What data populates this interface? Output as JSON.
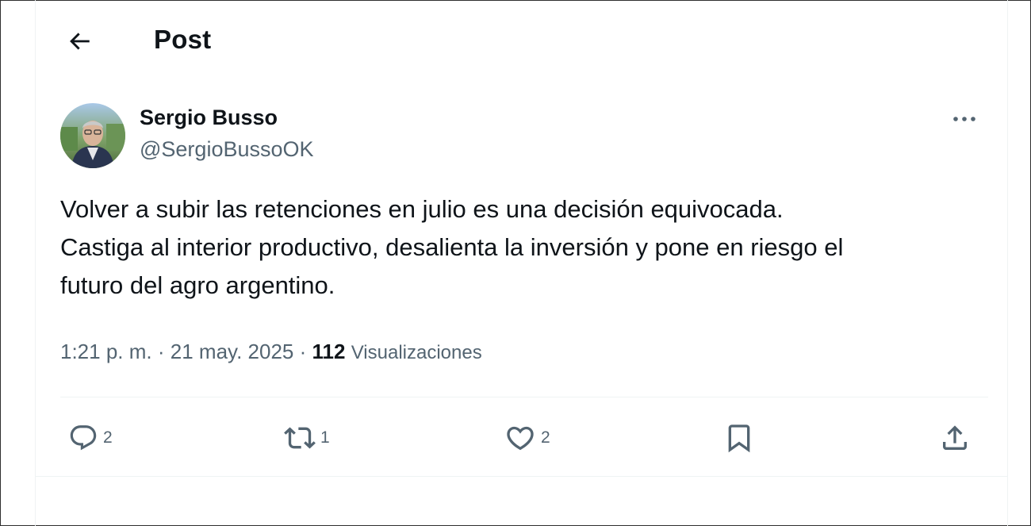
{
  "header": {
    "title": "Post",
    "back_icon": "arrow-left-icon"
  },
  "author": {
    "name": "Sergio Busso",
    "handle": "@SergioBussoOK",
    "more_icon": "more-horizontal-icon"
  },
  "tweet": {
    "lines": [
      "Volver a subir las retenciones en julio es una decisión equivocada.",
      "Castiga al interior productivo, desalienta la inversión y pone en riesgo el",
      "futuro del agro argentino."
    ]
  },
  "meta": {
    "time": "1:21 p. m.",
    "separator": "·",
    "date": "21 may. 2025",
    "views_count": "112",
    "views_label": "Visualizaciones"
  },
  "actions": {
    "reply": {
      "icon": "reply-icon",
      "count": "2"
    },
    "repost": {
      "icon": "repost-icon",
      "count": "1"
    },
    "like": {
      "icon": "heart-icon",
      "count": "2"
    },
    "bookmark": {
      "icon": "bookmark-icon"
    },
    "share": {
      "icon": "share-icon"
    }
  },
  "colors": {
    "text_primary": "#0f1419",
    "text_secondary": "#536471",
    "divider": "#eff3f4"
  }
}
